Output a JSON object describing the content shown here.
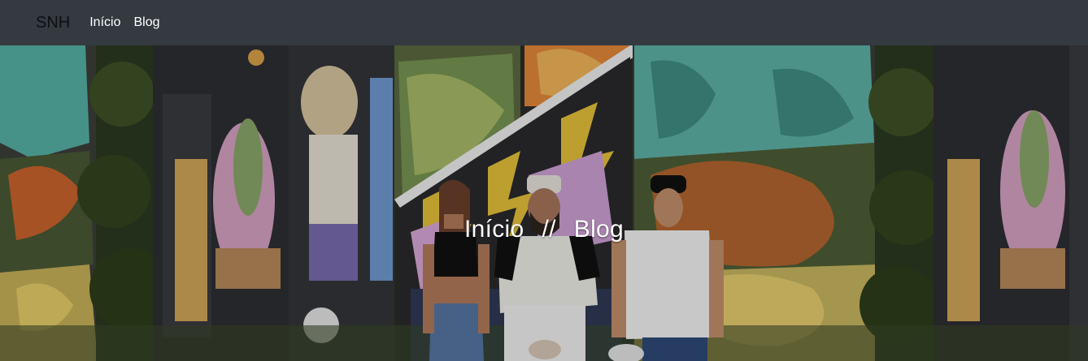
{
  "navbar": {
    "brand": "SNH",
    "links": [
      {
        "label": "Início"
      },
      {
        "label": "Blog"
      }
    ]
  },
  "hero": {
    "breadcrumb_home": "Início",
    "breadcrumb_separator": "//",
    "breadcrumb_current": "Blog",
    "image": "graffiti-wall-three-people-photo"
  },
  "colors": {
    "navbar_bg": "#343a40",
    "brand_text": "#0f0f12",
    "nav_text": "#ffffff",
    "hero_text": "#ffffff"
  }
}
